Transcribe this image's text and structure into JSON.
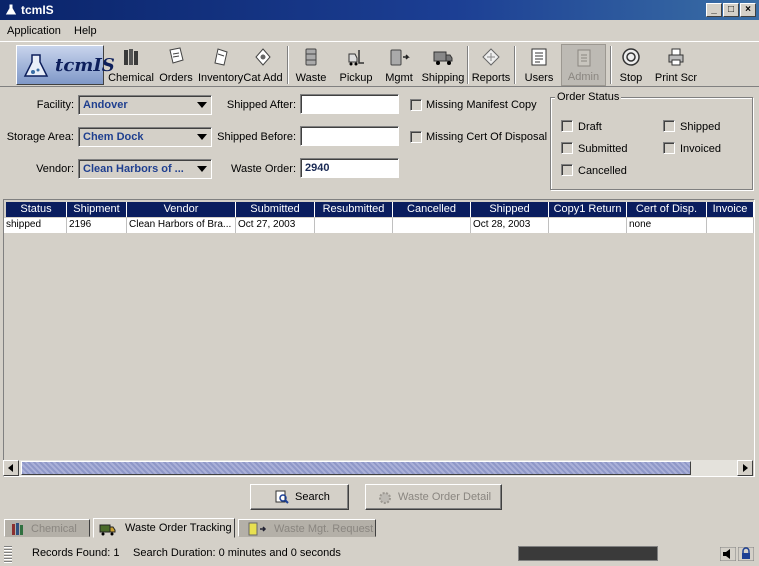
{
  "window": {
    "title": "tcmIS"
  },
  "menu": [
    "Application",
    "Help"
  ],
  "toolbar": {
    "logo_text": "tcmIS",
    "buttons": [
      {
        "label": "Chemical",
        "icon": "books-icon"
      },
      {
        "label": "Orders",
        "icon": "orders-icon"
      },
      {
        "label": "Inventory",
        "icon": "inventory-icon"
      },
      {
        "label": "Cat Add",
        "icon": "catalog-add-icon"
      },
      {
        "label": "Waste",
        "icon": "waste-drum-icon"
      },
      {
        "label": "Pickup",
        "icon": "forklift-icon"
      },
      {
        "label": "Mgmt",
        "icon": "drum-arrow-icon"
      },
      {
        "label": "Shipping",
        "icon": "truck-icon"
      },
      {
        "label": "Reports",
        "icon": "reports-icon"
      },
      {
        "label": "Users",
        "icon": "users-icon"
      },
      {
        "label": "Admin",
        "icon": "admin-icon",
        "disabled": true
      },
      {
        "label": "Stop",
        "icon": "stop-icon"
      },
      {
        "label": "Print Scr",
        "icon": "printer-icon"
      }
    ]
  },
  "filters": {
    "facility_label": "Facility:",
    "facility_value": "Andover",
    "storage_area_label": "Storage Area:",
    "storage_area_value": "Chem Dock",
    "vendor_label": "Vendor:",
    "vendor_value": "Clean Harbors of ...",
    "shipped_after_label": "Shipped After:",
    "shipped_after_value": "",
    "shipped_before_label": "Shipped Before:",
    "shipped_before_value": "",
    "waste_order_label": "Waste Order:",
    "waste_order_value": "2940",
    "missing_manifest_label": "Missing Manifest Copy",
    "missing_cert_label": "Missing Cert Of Disposal"
  },
  "order_status": {
    "title": "Order Status",
    "options": [
      "Draft",
      "Shipped",
      "Submitted",
      "Invoiced",
      "Cancelled"
    ]
  },
  "table": {
    "columns": [
      "Status",
      "Shipment",
      "Vendor",
      "Submitted",
      "Resubmitted",
      "Cancelled",
      "Shipped",
      "Copy1 Return",
      "Cert of Disp.",
      "Invoice"
    ],
    "rows": [
      [
        "shipped",
        "2196",
        "Clean Harbors of Bra...",
        "Oct 27, 2003",
        "",
        "",
        "Oct 28, 2003",
        "",
        "none",
        ""
      ]
    ]
  },
  "actions": {
    "search_label": "Search",
    "detail_label": "Waste Order Detail"
  },
  "tabs": [
    {
      "label": "Chemical",
      "active": false
    },
    {
      "label": "Waste Order Tracking",
      "active": true
    },
    {
      "label": "Waste Mgt. Request",
      "active": false
    }
  ],
  "status": {
    "records_found": "Records Found: 1",
    "search_duration": "Search Duration: 0 minutes and 0 seconds"
  }
}
